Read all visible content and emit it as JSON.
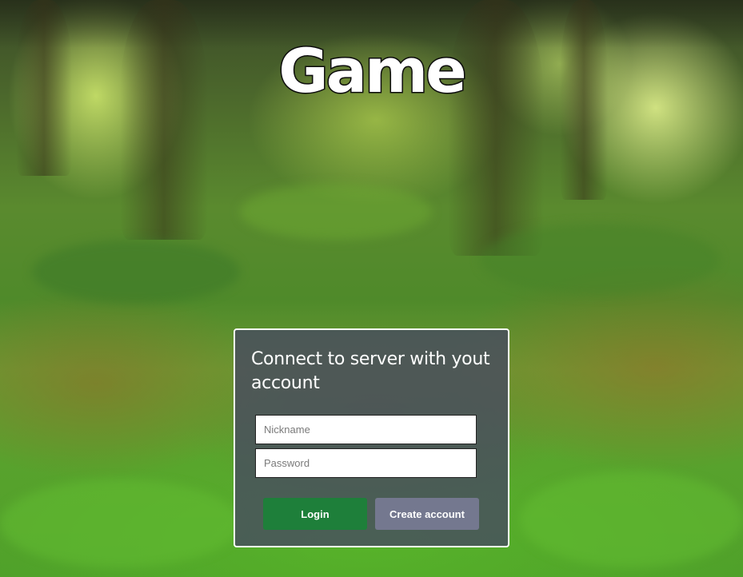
{
  "title": "Game",
  "login_panel": {
    "heading": "Connect to server with yout account",
    "nickname_placeholder": "Nickname",
    "password_placeholder": "Password",
    "login_label": "Login",
    "create_account_label": "Create account"
  },
  "colors": {
    "login_button": "#1e7f3a",
    "create_account_button": "#74788f",
    "panel_background": "#46486280"
  }
}
